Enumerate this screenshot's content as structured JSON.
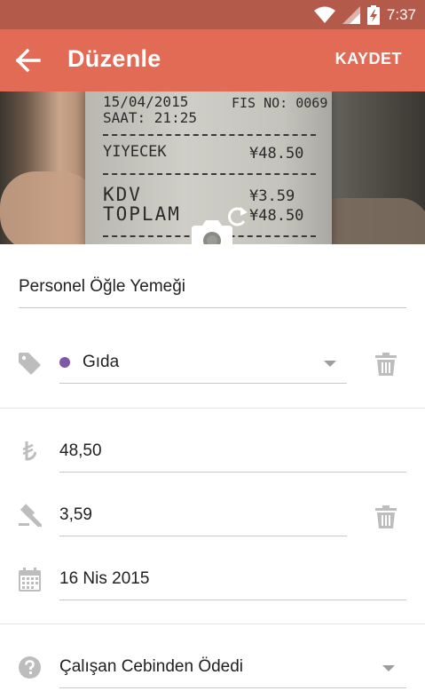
{
  "status_bar": {
    "time": "7:37"
  },
  "app_bar": {
    "title": "Düzenle",
    "save_label": "KAYDET"
  },
  "receipt_photo": {
    "date": "15/04/2015",
    "time": "SAAT: 21:25",
    "fis_no": "FIS NO: 0069",
    "item_name": "YIYECEK",
    "item_amount": "¥48.50",
    "kdv_label": "KDV",
    "kdv_amount": "¥3.59",
    "total_label": "TOPLAM",
    "total_amount": "¥48.50"
  },
  "form": {
    "description": "Personel Öğle Yemeği",
    "category": {
      "label": "Gıda",
      "color": "#7E57A8"
    },
    "amount": "48,50",
    "tax": "3,59",
    "date": "16 Nis 2015",
    "payment_method": "Çalışan Cebinden Ödedi"
  },
  "colors": {
    "app_bar": "#E26B56",
    "status_bar": "#B45A4B",
    "icon_gray": "#BDBDBD"
  }
}
